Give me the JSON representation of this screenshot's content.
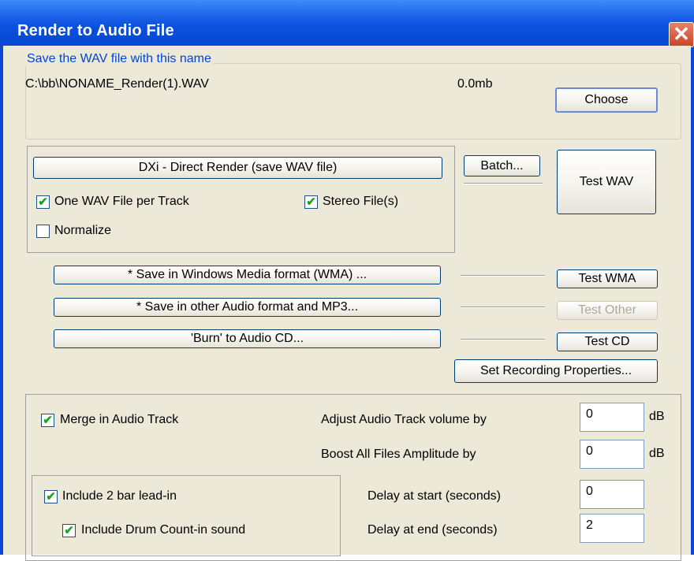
{
  "window": {
    "title": "Render to Audio File",
    "close_symbol": "✕"
  },
  "file": {
    "legend": "Save the WAV file with this name",
    "path": "C:\\bb\\NONAME_Render(1).WAV",
    "size": "0.0mb",
    "choose_label": "Choose"
  },
  "dxi": {
    "render_label": "DXi - Direct Render (save WAV file)",
    "one_wav_label": "One WAV File per Track",
    "one_wav_checked": true,
    "stereo_label": "Stereo File(s)",
    "stereo_checked": true,
    "normalize_label": "Normalize",
    "normalize_checked": false
  },
  "side_buttons": {
    "batch_label": "Batch...",
    "test_wav_label": "Test WAV"
  },
  "formats": {
    "wma_label": "* Save in Windows Media format (WMA) ...",
    "test_wma_label": "Test WMA",
    "other_label": "* Save in other Audio format and MP3...",
    "test_other_label": "Test Other",
    "cd_label": "'Burn' to Audio CD...",
    "test_cd_label": "Test CD",
    "recording_label": "Set Recording Properties..."
  },
  "audio": {
    "merge_label": "Merge in Audio Track",
    "merge_checked": true,
    "adjust_label": "Adjust Audio Track volume by",
    "adjust_value": "0",
    "adjust_unit": "dB",
    "boost_label": "Boost All Files Amplitude by",
    "boost_value": "0",
    "boost_unit": "dB",
    "leadin_label": "Include 2 bar lead-in",
    "leadin_checked": true,
    "drum_label": "Include Drum Count-in sound",
    "drum_checked": true,
    "delay_start_label": "Delay at start (seconds)",
    "delay_start_value": "0",
    "delay_end_label": "Delay at end (seconds)",
    "delay_end_value": "2"
  },
  "check_glyph": "✔"
}
